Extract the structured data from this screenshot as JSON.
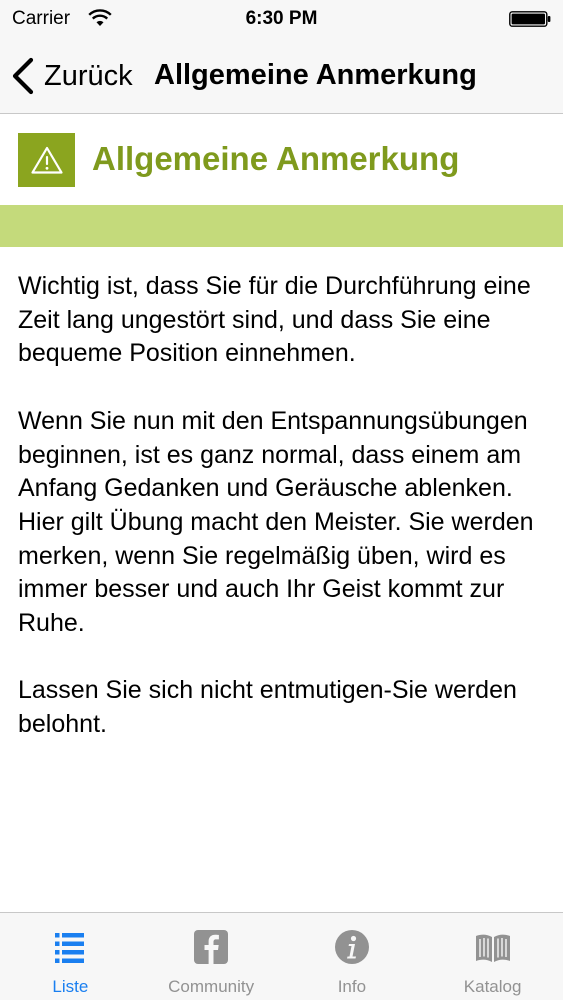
{
  "status_bar": {
    "carrier": "Carrier",
    "time": "6:30 PM"
  },
  "nav": {
    "back_label": "Zurück",
    "title": "Allgemeine Anmerkung"
  },
  "header": {
    "icon": "warning-icon",
    "title": "Allgemeine Anmerkung",
    "accent_color": "#8ba51f",
    "strip_color": "#c4da7b"
  },
  "content": {
    "paragraphs": [
      "Wichtig ist, dass Sie für die Durchführung eine Zeit lang ungestört sind, und dass Sie eine bequeme Position einnehmen.",
      "Wenn Sie nun mit den Entspannungsübungen beginnen, ist es ganz normal, dass einem am Anfang Gedanken und Geräusche ablenken. Hier gilt Übung macht den Meister. Sie werden merken, wenn Sie regelmäßig üben, wird es immer besser und auch Ihr Geist kommt zur Ruhe.",
      "Lassen Sie sich nicht entmutigen-Sie werden belohnt."
    ]
  },
  "tabs": [
    {
      "label": "Liste",
      "icon": "list-icon",
      "active": true
    },
    {
      "label": "Community",
      "icon": "facebook-icon",
      "active": false
    },
    {
      "label": "Info",
      "icon": "info-icon",
      "active": false
    },
    {
      "label": "Katalog",
      "icon": "book-icon",
      "active": false
    }
  ],
  "colors": {
    "tab_active": "#1a7ff0",
    "tab_inactive": "#929292"
  }
}
